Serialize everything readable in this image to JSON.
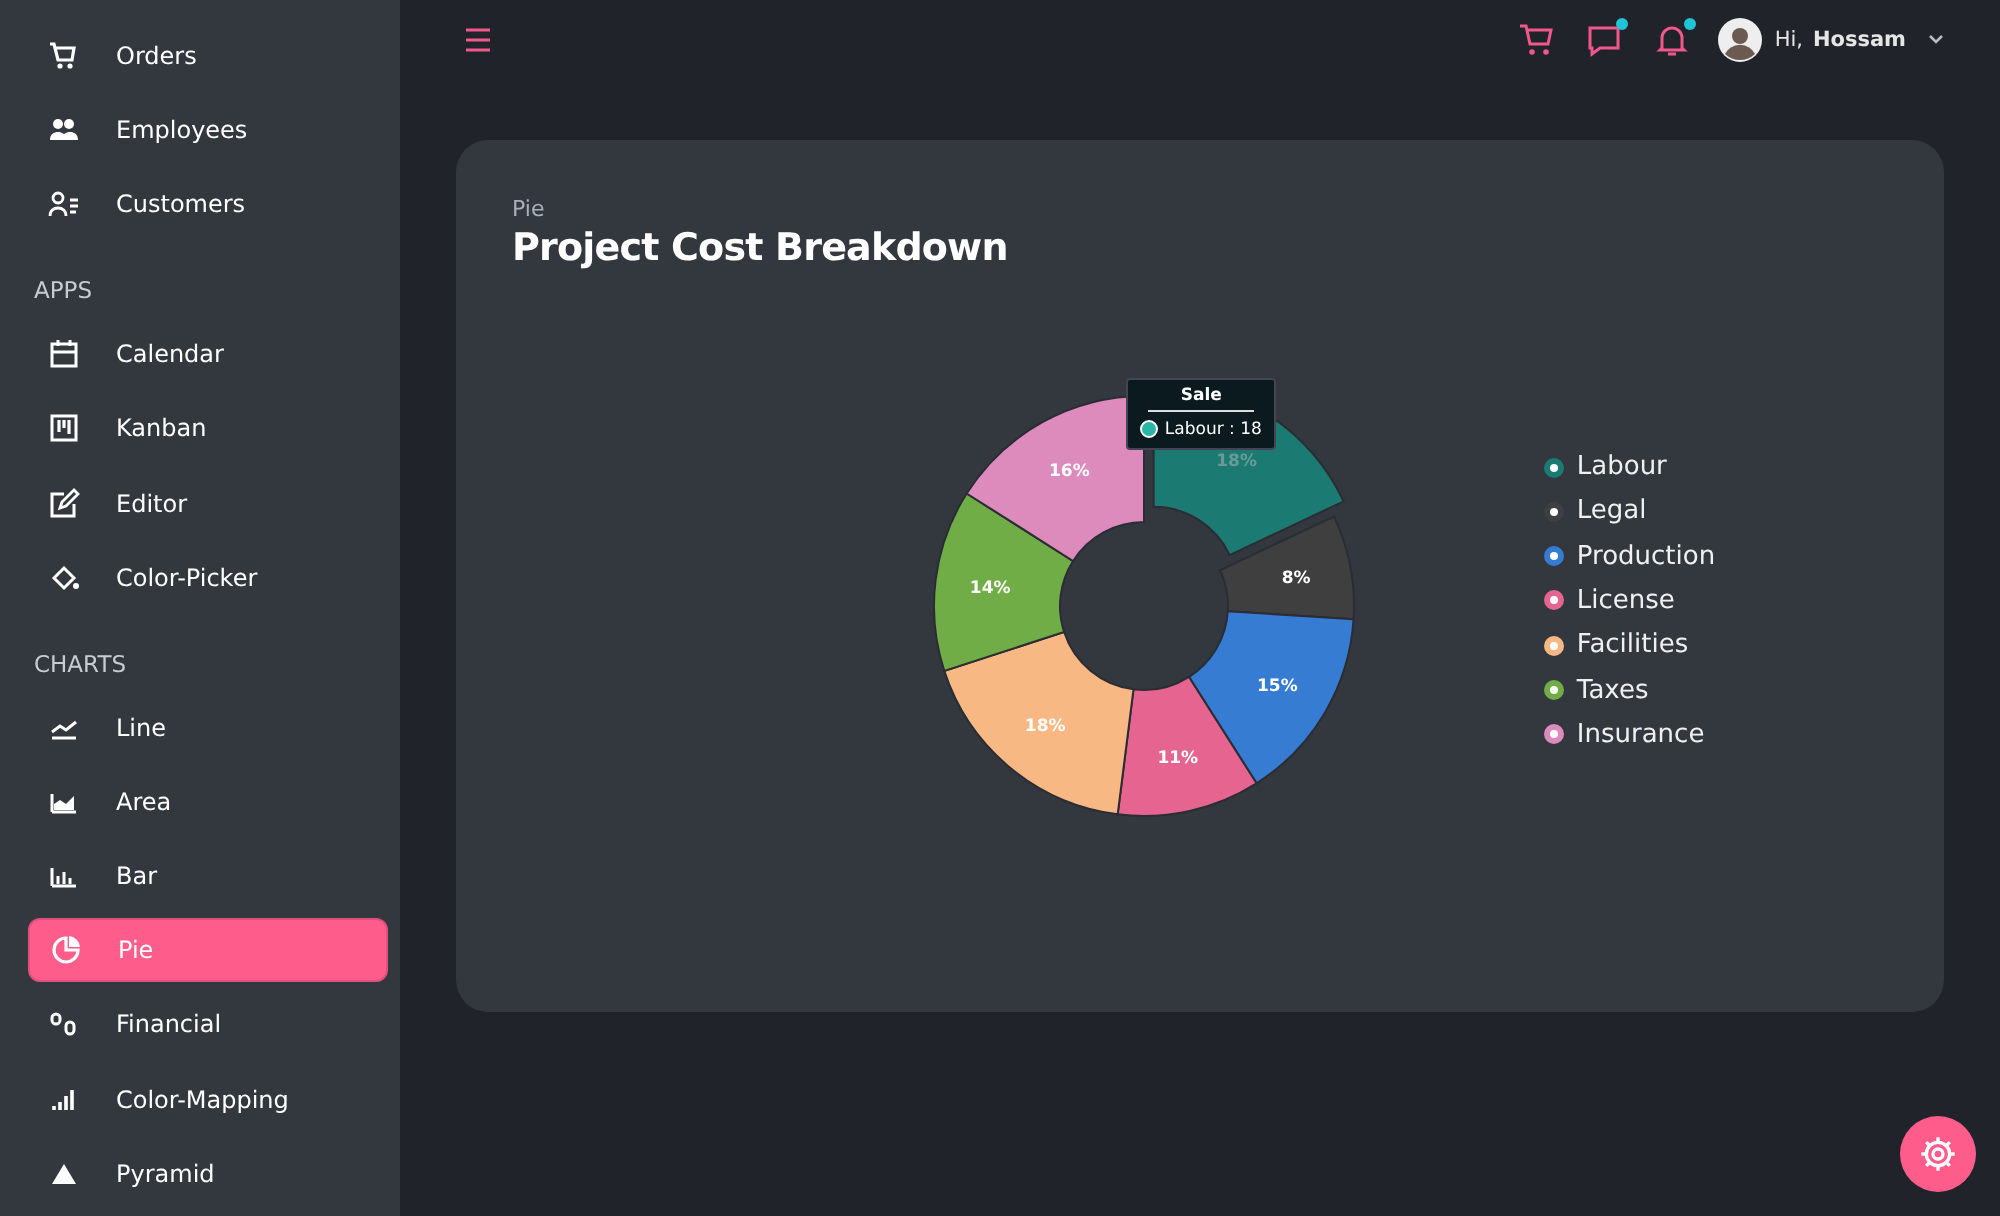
{
  "sidebar": {
    "sections": [
      {
        "items": [
          {
            "label": "Orders",
            "selected": false
          },
          {
            "label": "Employees",
            "selected": false
          },
          {
            "label": "Customers",
            "selected": false
          }
        ]
      },
      {
        "heading": "APPS",
        "items": [
          {
            "label": "Calendar",
            "selected": false
          },
          {
            "label": "Kanban",
            "selected": false
          },
          {
            "label": "Editor",
            "selected": false
          },
          {
            "label": "Color-Picker",
            "selected": false
          }
        ]
      },
      {
        "heading": "CHARTS",
        "items": [
          {
            "label": "Line",
            "selected": false
          },
          {
            "label": "Area",
            "selected": false
          },
          {
            "label": "Bar",
            "selected": false
          },
          {
            "label": "Pie",
            "selected": true
          },
          {
            "label": "Financial",
            "selected": false
          },
          {
            "label": "Color-Mapping",
            "selected": false
          },
          {
            "label": "Pyramid",
            "selected": false
          }
        ]
      }
    ]
  },
  "topbar": {
    "greeting": "Hi,",
    "user": "Hossam",
    "chat_badge": true,
    "notifications_badge": true
  },
  "card": {
    "category": "Pie",
    "title": "Project Cost Breakdown",
    "chart_data": {
      "type": "donut",
      "categories": [
        "Labour",
        "Legal",
        "Production",
        "License",
        "Facilities",
        "Taxes",
        "Insurance"
      ],
      "series": [
        {
          "name": "Sale",
          "values": [
            18,
            8,
            15,
            11,
            18,
            14,
            16
          ]
        }
      ],
      "value_labels": [
        "18%",
        "8%",
        "15%",
        "11%",
        "18%",
        "14%",
        "16%"
      ]
    },
    "legend": [
      {
        "color": "#1b7a72",
        "selected": true
      },
      {
        "color": "#3f3f3f",
        "selected": false
      },
      {
        "color": "#357cd2",
        "selected": false
      },
      {
        "color": "#e56590",
        "selected": false
      },
      {
        "color": "#f8b883",
        "selected": false
      },
      {
        "color": "#70ad47",
        "selected": false
      },
      {
        "color": "#dd8abd",
        "selected": false
      }
    ],
    "tooltip": {
      "text": "Labour : 18"
    }
  }
}
